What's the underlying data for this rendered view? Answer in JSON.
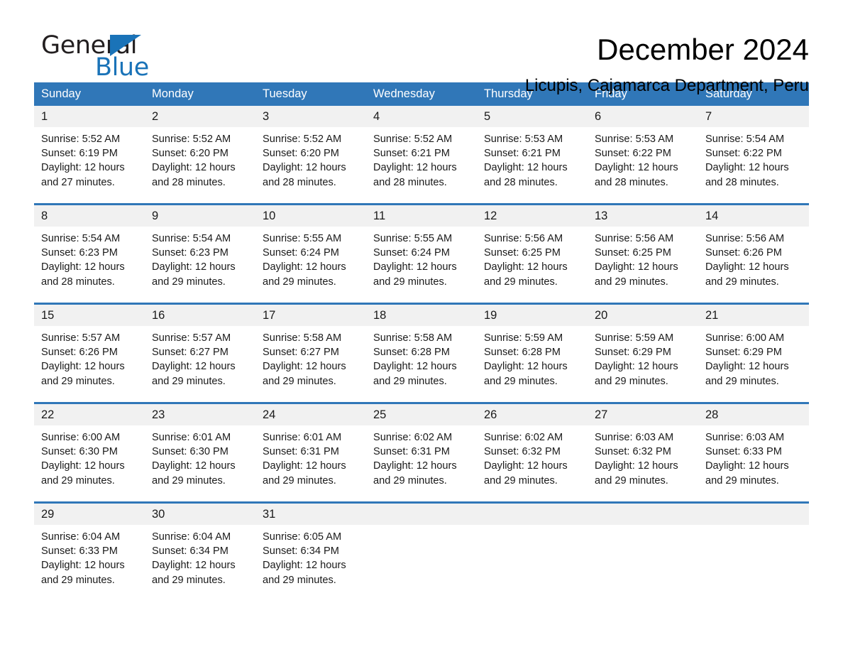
{
  "brand": {
    "name_part1": "General",
    "name_part2": "Blue",
    "logo_icon": "triangle-logo-icon",
    "accent_color": "#1a73b8"
  },
  "header": {
    "title": "December 2024",
    "subtitle": "Licupis, Cajamarca Department, Peru"
  },
  "colors": {
    "header_blue": "#3077b8",
    "day_band_gray": "#f1f1f1",
    "text": "#1a1a1a"
  },
  "weekday_headers": [
    "Sunday",
    "Monday",
    "Tuesday",
    "Wednesday",
    "Thursday",
    "Friday",
    "Saturday"
  ],
  "weeks": [
    [
      {
        "day": "1",
        "sunrise": "Sunrise: 5:52 AM",
        "sunset": "Sunset: 6:19 PM",
        "daylight_line1": "Daylight: 12 hours",
        "daylight_line2": "and 27 minutes."
      },
      {
        "day": "2",
        "sunrise": "Sunrise: 5:52 AM",
        "sunset": "Sunset: 6:20 PM",
        "daylight_line1": "Daylight: 12 hours",
        "daylight_line2": "and 28 minutes."
      },
      {
        "day": "3",
        "sunrise": "Sunrise: 5:52 AM",
        "sunset": "Sunset: 6:20 PM",
        "daylight_line1": "Daylight: 12 hours",
        "daylight_line2": "and 28 minutes."
      },
      {
        "day": "4",
        "sunrise": "Sunrise: 5:52 AM",
        "sunset": "Sunset: 6:21 PM",
        "daylight_line1": "Daylight: 12 hours",
        "daylight_line2": "and 28 minutes."
      },
      {
        "day": "5",
        "sunrise": "Sunrise: 5:53 AM",
        "sunset": "Sunset: 6:21 PM",
        "daylight_line1": "Daylight: 12 hours",
        "daylight_line2": "and 28 minutes."
      },
      {
        "day": "6",
        "sunrise": "Sunrise: 5:53 AM",
        "sunset": "Sunset: 6:22 PM",
        "daylight_line1": "Daylight: 12 hours",
        "daylight_line2": "and 28 minutes."
      },
      {
        "day": "7",
        "sunrise": "Sunrise: 5:54 AM",
        "sunset": "Sunset: 6:22 PM",
        "daylight_line1": "Daylight: 12 hours",
        "daylight_line2": "and 28 minutes."
      }
    ],
    [
      {
        "day": "8",
        "sunrise": "Sunrise: 5:54 AM",
        "sunset": "Sunset: 6:23 PM",
        "daylight_line1": "Daylight: 12 hours",
        "daylight_line2": "and 28 minutes."
      },
      {
        "day": "9",
        "sunrise": "Sunrise: 5:54 AM",
        "sunset": "Sunset: 6:23 PM",
        "daylight_line1": "Daylight: 12 hours",
        "daylight_line2": "and 29 minutes."
      },
      {
        "day": "10",
        "sunrise": "Sunrise: 5:55 AM",
        "sunset": "Sunset: 6:24 PM",
        "daylight_line1": "Daylight: 12 hours",
        "daylight_line2": "and 29 minutes."
      },
      {
        "day": "11",
        "sunrise": "Sunrise: 5:55 AM",
        "sunset": "Sunset: 6:24 PM",
        "daylight_line1": "Daylight: 12 hours",
        "daylight_line2": "and 29 minutes."
      },
      {
        "day": "12",
        "sunrise": "Sunrise: 5:56 AM",
        "sunset": "Sunset: 6:25 PM",
        "daylight_line1": "Daylight: 12 hours",
        "daylight_line2": "and 29 minutes."
      },
      {
        "day": "13",
        "sunrise": "Sunrise: 5:56 AM",
        "sunset": "Sunset: 6:25 PM",
        "daylight_line1": "Daylight: 12 hours",
        "daylight_line2": "and 29 minutes."
      },
      {
        "day": "14",
        "sunrise": "Sunrise: 5:56 AM",
        "sunset": "Sunset: 6:26 PM",
        "daylight_line1": "Daylight: 12 hours",
        "daylight_line2": "and 29 minutes."
      }
    ],
    [
      {
        "day": "15",
        "sunrise": "Sunrise: 5:57 AM",
        "sunset": "Sunset: 6:26 PM",
        "daylight_line1": "Daylight: 12 hours",
        "daylight_line2": "and 29 minutes."
      },
      {
        "day": "16",
        "sunrise": "Sunrise: 5:57 AM",
        "sunset": "Sunset: 6:27 PM",
        "daylight_line1": "Daylight: 12 hours",
        "daylight_line2": "and 29 minutes."
      },
      {
        "day": "17",
        "sunrise": "Sunrise: 5:58 AM",
        "sunset": "Sunset: 6:27 PM",
        "daylight_line1": "Daylight: 12 hours",
        "daylight_line2": "and 29 minutes."
      },
      {
        "day": "18",
        "sunrise": "Sunrise: 5:58 AM",
        "sunset": "Sunset: 6:28 PM",
        "daylight_line1": "Daylight: 12 hours",
        "daylight_line2": "and 29 minutes."
      },
      {
        "day": "19",
        "sunrise": "Sunrise: 5:59 AM",
        "sunset": "Sunset: 6:28 PM",
        "daylight_line1": "Daylight: 12 hours",
        "daylight_line2": "and 29 minutes."
      },
      {
        "day": "20",
        "sunrise": "Sunrise: 5:59 AM",
        "sunset": "Sunset: 6:29 PM",
        "daylight_line1": "Daylight: 12 hours",
        "daylight_line2": "and 29 minutes."
      },
      {
        "day": "21",
        "sunrise": "Sunrise: 6:00 AM",
        "sunset": "Sunset: 6:29 PM",
        "daylight_line1": "Daylight: 12 hours",
        "daylight_line2": "and 29 minutes."
      }
    ],
    [
      {
        "day": "22",
        "sunrise": "Sunrise: 6:00 AM",
        "sunset": "Sunset: 6:30 PM",
        "daylight_line1": "Daylight: 12 hours",
        "daylight_line2": "and 29 minutes."
      },
      {
        "day": "23",
        "sunrise": "Sunrise: 6:01 AM",
        "sunset": "Sunset: 6:30 PM",
        "daylight_line1": "Daylight: 12 hours",
        "daylight_line2": "and 29 minutes."
      },
      {
        "day": "24",
        "sunrise": "Sunrise: 6:01 AM",
        "sunset": "Sunset: 6:31 PM",
        "daylight_line1": "Daylight: 12 hours",
        "daylight_line2": "and 29 minutes."
      },
      {
        "day": "25",
        "sunrise": "Sunrise: 6:02 AM",
        "sunset": "Sunset: 6:31 PM",
        "daylight_line1": "Daylight: 12 hours",
        "daylight_line2": "and 29 minutes."
      },
      {
        "day": "26",
        "sunrise": "Sunrise: 6:02 AM",
        "sunset": "Sunset: 6:32 PM",
        "daylight_line1": "Daylight: 12 hours",
        "daylight_line2": "and 29 minutes."
      },
      {
        "day": "27",
        "sunrise": "Sunrise: 6:03 AM",
        "sunset": "Sunset: 6:32 PM",
        "daylight_line1": "Daylight: 12 hours",
        "daylight_line2": "and 29 minutes."
      },
      {
        "day": "28",
        "sunrise": "Sunrise: 6:03 AM",
        "sunset": "Sunset: 6:33 PM",
        "daylight_line1": "Daylight: 12 hours",
        "daylight_line2": "and 29 minutes."
      }
    ],
    [
      {
        "day": "29",
        "sunrise": "Sunrise: 6:04 AM",
        "sunset": "Sunset: 6:33 PM",
        "daylight_line1": "Daylight: 12 hours",
        "daylight_line2": "and 29 minutes."
      },
      {
        "day": "30",
        "sunrise": "Sunrise: 6:04 AM",
        "sunset": "Sunset: 6:34 PM",
        "daylight_line1": "Daylight: 12 hours",
        "daylight_line2": "and 29 minutes."
      },
      {
        "day": "31",
        "sunrise": "Sunrise: 6:05 AM",
        "sunset": "Sunset: 6:34 PM",
        "daylight_line1": "Daylight: 12 hours",
        "daylight_line2": "and 29 minutes."
      },
      {
        "day": "",
        "sunrise": "",
        "sunset": "",
        "daylight_line1": "",
        "daylight_line2": ""
      },
      {
        "day": "",
        "sunrise": "",
        "sunset": "",
        "daylight_line1": "",
        "daylight_line2": ""
      },
      {
        "day": "",
        "sunrise": "",
        "sunset": "",
        "daylight_line1": "",
        "daylight_line2": ""
      },
      {
        "day": "",
        "sunrise": "",
        "sunset": "",
        "daylight_line1": "",
        "daylight_line2": ""
      }
    ]
  ]
}
